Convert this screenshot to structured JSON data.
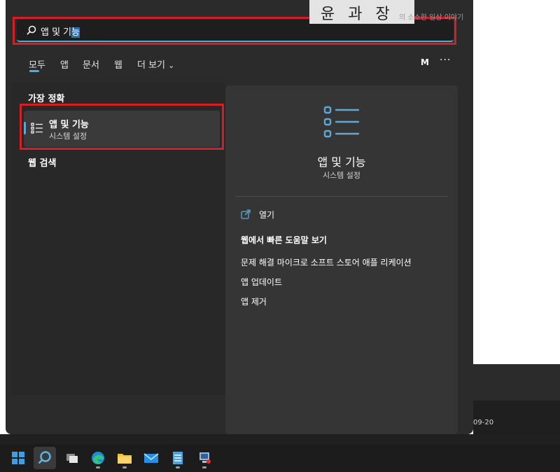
{
  "watermark": {
    "title": "윤 과 장",
    "subtitle": "의 소소한 일상 이야기"
  },
  "background": {
    "date_text": "09-20"
  },
  "search": {
    "query_prefix": "앱 및 기",
    "query_selected": "능"
  },
  "tabs": {
    "items": [
      {
        "label": "모두"
      },
      {
        "label": "앱"
      },
      {
        "label": "문서"
      },
      {
        "label": "웹"
      },
      {
        "label": "더 보기"
      }
    ],
    "more_chevron": "⌄",
    "avatar_letter": "M",
    "overflow": "···"
  },
  "results": {
    "best_match_heading": "가장 정확",
    "best_match": {
      "title": "앱 및 기능",
      "subtitle": "시스템 설정"
    },
    "web_search_heading": "웹 검색"
  },
  "detail": {
    "title": "앱 및 기능",
    "subtitle": "시스템 설정",
    "open_label": "열기",
    "web_help_heading": "웹에서 빠른 도움말 보기",
    "web_links": [
      {
        "label": "문제 해결 마이크로 소프트 스토어 애플 리케이션"
      },
      {
        "label": "앱 업데이트"
      },
      {
        "label": "앱 제거"
      }
    ]
  },
  "taskbar": {
    "icons": [
      "windows-start-icon",
      "search-icon",
      "task-view-icon",
      "edge-icon",
      "file-explorer-icon",
      "mail-icon",
      "notepad-icon",
      "network-app-icon"
    ]
  },
  "colors": {
    "accent": "#5fa8d6",
    "highlight": "#d21f26",
    "panel": "#2b2b2b"
  }
}
